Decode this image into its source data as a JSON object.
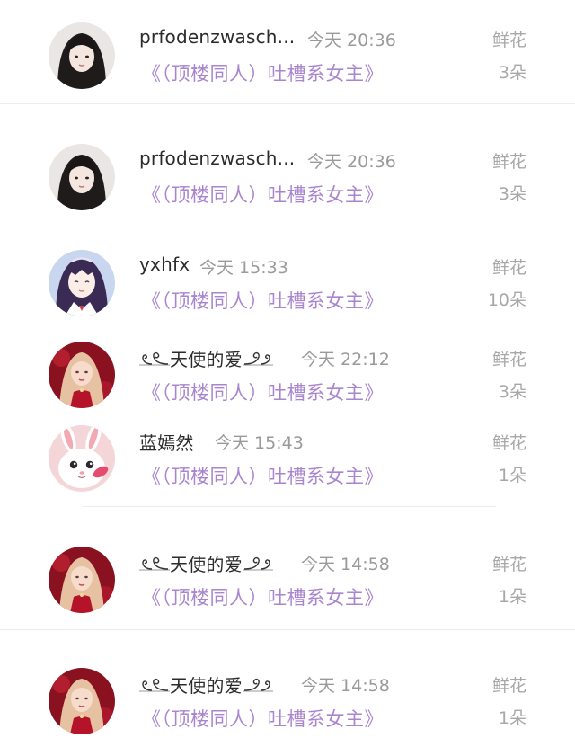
{
  "rows": [
    {
      "username": "prfodenzwasch...",
      "time": "今天 20:36",
      "book": "《（顶楼同人）吐槽系女主》",
      "gift_label": "鲜花",
      "gift_count": "3朵"
    },
    {
      "username": "prfodenzwasch...",
      "time": "今天 20:36",
      "book": "《（顶楼同人）吐槽系女主》",
      "gift_label": "鲜花",
      "gift_count": "3朵"
    },
    {
      "username": "yxhfx",
      "time": "今天 15:33",
      "book": "《（顶楼同人）吐槽系女主》",
      "gift_label": "鲜花",
      "gift_count": "10朵"
    },
    {
      "username": "天使的爱",
      "time": "今天 22:12",
      "book": "《（顶楼同人）吐槽系女主》",
      "gift_label": "鲜花",
      "gift_count": "3朵"
    },
    {
      "username": "蓝嫣然",
      "time": "今天 15:43",
      "book": "《（顶楼同人）吐槽系女主》",
      "gift_label": "鲜花",
      "gift_count": "1朵"
    },
    {
      "username": "天使的爱",
      "time": "今天 14:58",
      "book": "《（顶楼同人）吐槽系女主》",
      "gift_label": "鲜花",
      "gift_count": "1朵"
    },
    {
      "username": "天使的爱",
      "time": "今天 14:58",
      "book": "《（顶楼同人）吐槽系女主》",
      "gift_label": "鲜花",
      "gift_count": "1朵"
    }
  ],
  "colors": {
    "book_title": "#a985cf",
    "username": "#2b2b2b",
    "meta": "#9a9a9a"
  },
  "icons": {
    "decor_left": "swirl-flourish",
    "decor_right": "swirl-flourish"
  }
}
